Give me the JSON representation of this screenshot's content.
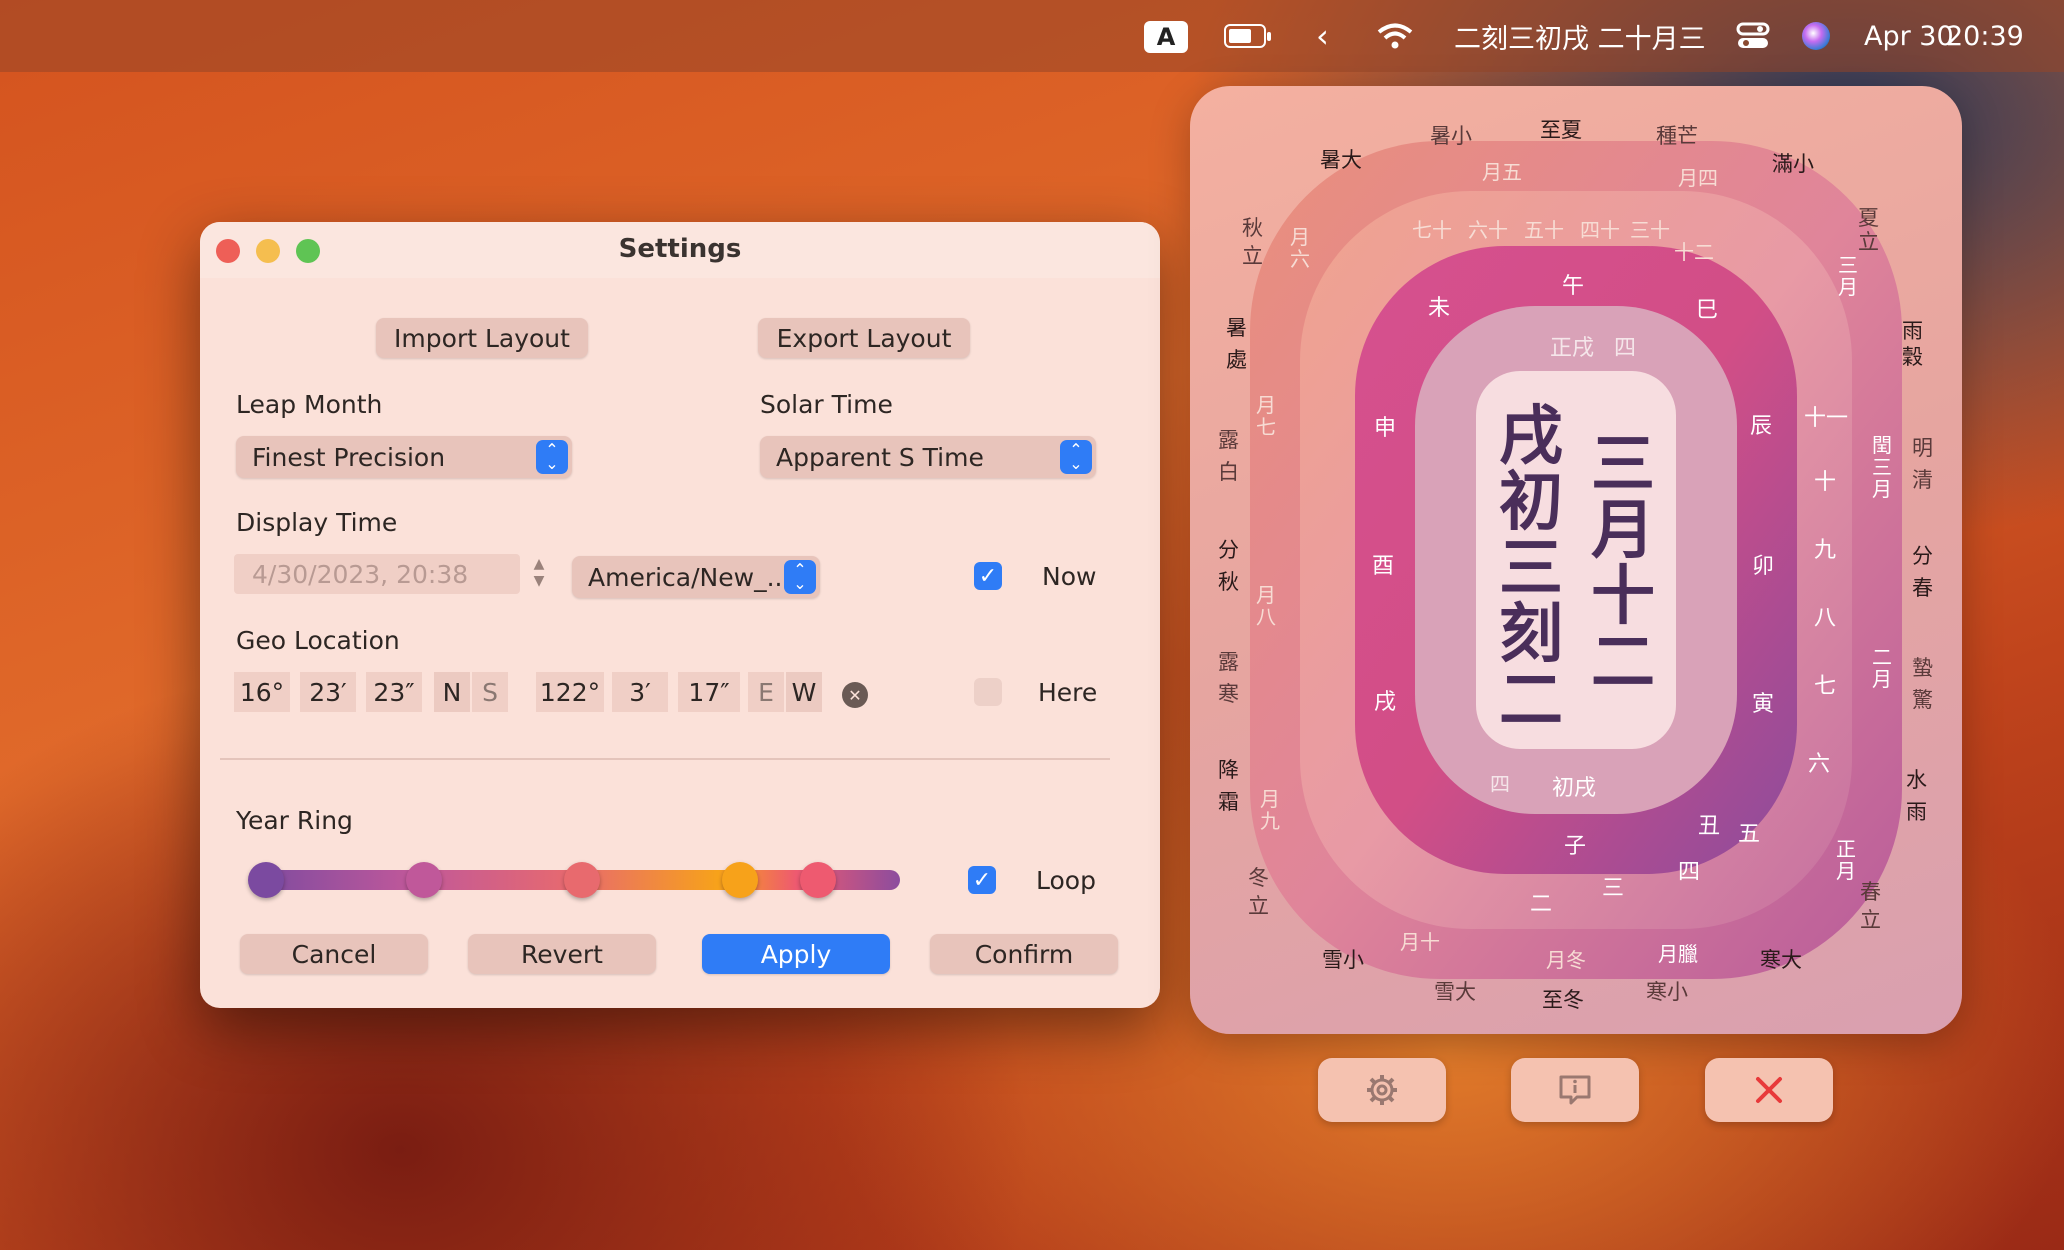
{
  "menubar": {
    "input_source": "A",
    "chinese_time": "二刻三初戌 二十月三",
    "date": "Apr 30",
    "time": "20:39",
    "icons": [
      "input-source-icon",
      "battery-icon",
      "chevron-left-icon",
      "wifi-icon",
      "control-center-icon",
      "siri-icon"
    ]
  },
  "settings": {
    "title": "Settings",
    "import_label": "Import Layout",
    "export_label": "Export Layout",
    "leap_month_label": "Leap Month",
    "leap_month_value": "Finest Precision",
    "solar_time_label": "Solar Time",
    "solar_time_value": "Apparent S Time",
    "display_time_label": "Display Time",
    "display_time_value": "4/30/2023, 20:38",
    "timezone_value": "America/New_...",
    "now_label": "Now",
    "now_checked": true,
    "geo_label": "Geo Location",
    "lat": {
      "deg": "16°",
      "min": "23′",
      "sec": "23″",
      "n": "N",
      "s": "S"
    },
    "lon": {
      "deg": "122°",
      "min": "3′",
      "sec": "17″",
      "e": "E",
      "w": "W"
    },
    "here_label": "Here",
    "here_checked": false,
    "year_ring_label": "Year Ring",
    "loop_label": "Loop",
    "loop_checked": true,
    "slider_stops": [
      "#7b4aa0",
      "#c0589a",
      "#e86a6e",
      "#f7a21a",
      "#ee5a70"
    ],
    "cancel_label": "Cancel",
    "revert_label": "Revert",
    "apply_label": "Apply",
    "confirm_label": "Confirm"
  },
  "clock": {
    "center_left": "戌初三刻二",
    "center_right": "三月十二",
    "inner_top": "正戌",
    "inner_top_right": "四",
    "inner_bottom": "初戌",
    "inner_bottom_left": "四",
    "hours": [
      "午",
      "巳",
      "辰",
      "卯",
      "寅",
      "丑",
      "子",
      "戌",
      "酉",
      "申",
      "未"
    ],
    "months": [
      "月五",
      "月四",
      "三月",
      "閏三月",
      "二月",
      "正月",
      "月臘",
      "月冬",
      "月十",
      "月九",
      "月八",
      "月七",
      "月六"
    ],
    "terms": [
      "至夏",
      "種芒",
      "滿小",
      "夏立",
      "雨穀",
      "明清",
      "分春",
      "蟄驚",
      "水雨",
      "春立",
      "寒大",
      "寒小",
      "至冬",
      "雪大",
      "雪小",
      "冬立",
      "降霜",
      "露寒",
      "分秋",
      "露白",
      "暑處",
      "秋立",
      "暑大",
      "暑小"
    ],
    "days": [
      "七十",
      "六十",
      "五十",
      "四十",
      "三十",
      "十二",
      "十一",
      "十",
      "九",
      "八",
      "七",
      "六",
      "五",
      "四",
      "三",
      "二"
    ],
    "widget_buttons": [
      "gear-icon",
      "info-icon",
      "close-icon"
    ]
  }
}
